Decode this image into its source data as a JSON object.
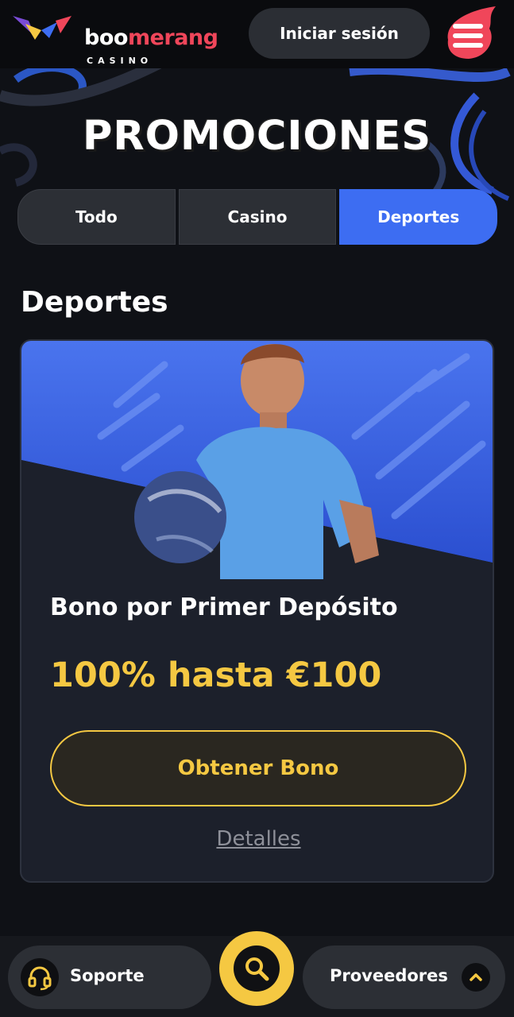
{
  "header": {
    "logo": {
      "word_main": "boo",
      "word_accent_1": "mer",
      "word_accent_2": "ang",
      "subtitle": "CASINO"
    },
    "login_label": "Iniciar sesión",
    "menu_icon": "hamburger-menu-icon"
  },
  "page_title": "PROMOCIONES",
  "tabs": [
    {
      "label": "Todo",
      "active": false
    },
    {
      "label": "Casino",
      "active": false
    },
    {
      "label": "Deportes",
      "active": true
    }
  ],
  "section_heading": "Deportes",
  "promo": {
    "title": "Bono por Primer Depósito",
    "offer": "100% hasta €100",
    "cta_label": "Obtener Bono",
    "details_label": "Detalles"
  },
  "bottom_bar": {
    "support_label": "Soporte",
    "providers_label": "Proveedores",
    "search_icon": "search-icon",
    "support_icon": "headset-icon",
    "providers_icon": "chevron-up-icon"
  },
  "colors": {
    "accent_blue": "#3d6df2",
    "accent_yellow": "#f5c842",
    "accent_red": "#f0465a",
    "background": "#0f1116"
  }
}
